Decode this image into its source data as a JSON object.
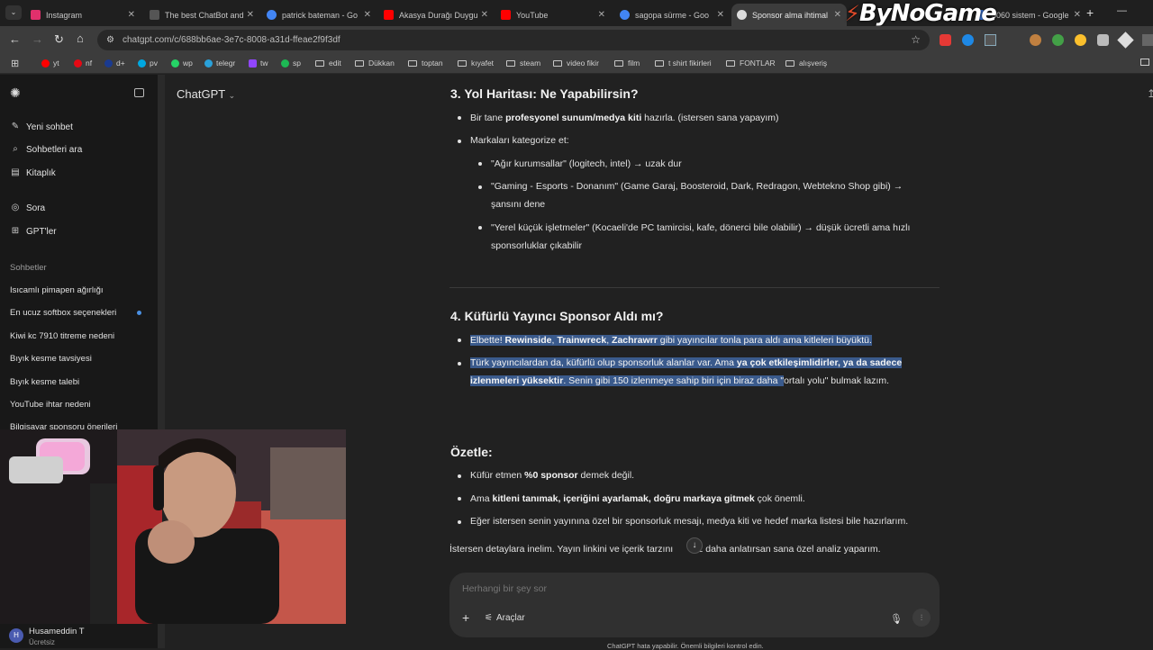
{
  "tabs": [
    {
      "title": "Instagram",
      "color": "#e1306c"
    },
    {
      "title": "The best ChatBot and",
      "color": "#444444"
    },
    {
      "title": "patrick bateman - Go",
      "color": "#4285f4"
    },
    {
      "title": "Akasya Durağı Duygu",
      "color": "#ff0000"
    },
    {
      "title": "YouTube",
      "color": "#ff0000"
    },
    {
      "title": "sagopa sürme - Goo",
      "color": "#4285f4"
    },
    {
      "title": "Sponsor alma ihtimal",
      "color": "#ffffff"
    },
    {
      "title": "5060 sistem - Google",
      "color": "#4285f4"
    }
  ],
  "new_tab": "+",
  "url": "chatgpt.com/c/688bb6ae-3e7c-8008-a31d-ffeae2f9f3df",
  "bookmarks": [
    "yt",
    "nf",
    "d+",
    "pv",
    "wp",
    "telegr",
    "tw",
    "sp",
    "edit",
    "Dükkan",
    "toptan",
    "kıyafet",
    "steam",
    "video fikir",
    "film",
    "t shirt fikirleri",
    "FONTLAR",
    "alışveriş"
  ],
  "logo": "ByNoGame",
  "sidebar": {
    "model": "ChatGPT",
    "nav": [
      {
        "label": "Yeni sohbet",
        "icon": "✎"
      },
      {
        "label": "Sohbetleri ara",
        "icon": "⌕"
      },
      {
        "label": "Kitaplık",
        "icon": "▤"
      },
      {
        "label": "Sora",
        "icon": "◎"
      },
      {
        "label": "GPT'ler",
        "icon": "⊞"
      }
    ],
    "section": "Sohbetler",
    "chats": [
      "Isıcamlı pimapen ağırlığı",
      "En ucuz softbox seçenekleri",
      "Kiwi kc 7910 titreme nedeni",
      "Bıyık kesme tavsiyesi",
      "Bıyık kesme talebi",
      "YouTube ihtar nedeni",
      "Bilgisayar sponsoru önerileri"
    ],
    "user_initial": "H",
    "user_name": "Husameddin T",
    "user_plan": "Ücretsiz"
  },
  "content": {
    "h3": "3. Yol Haritası: Ne Yapabilirsin?",
    "r1_a": "Bir tane ",
    "r1_b": "profesyonel sunum/medya kiti",
    "r1_c": " hazırla. (istersen sana yapayım)",
    "r2": "Markaları kategorize et:",
    "s1": "\"Ağır kurumsallar\" (logitech, intel) → uzak dur",
    "s2a": "\"Gaming - Esports - Donanım\" (Game Garaj, Boosteroid, Dark, Redragon, Webtekno Shop gibi) →",
    "s2b": "şansını dene",
    "s3a": "\"Yerel küçük işletmeler\" (Kocaeli'de PC tamircisi, kafe, dönerci bile olabilir) → düşük ücretli ama hızlı",
    "s3b": "sponsorluklar çıkabilir",
    "h4": "4. Küfürlü Yayıncı Sponsor Aldı mı?",
    "k1a": "Elbette! ",
    "k1b": "Rewinside",
    "k1c": ", ",
    "k1d": "Trainwreck",
    "k1e": ", ",
    "k1f": "Zachrawrr",
    "k1g": " gibi yayıncılar tonla para aldı ama kitleleri büyüktü.",
    "k2a": "Türk yayıncılardan da, küfürlü olup sponsorluk alanlar var. Ama ",
    "k2b": "ya çok etkileşimlidirler, ya da sadece",
    "k2c": "izlenmeleri yüksektir",
    "k2d": ". Senin gibi 150 izlenmeye sahip biri için biraz daha \"",
    "k2e": "ortalı yolu\" bulmak lazım.",
    "hs": "Özetle:",
    "o1a": "Küfür etmen ",
    "o1b": "%0 sponsor",
    "o1c": " demek değil.",
    "o2a": "Ama ",
    "o2b": "kitleni tanımak, içeriğini ayarlamak, doğru markaya gitmek",
    "o2c": " çok önemli.",
    "o3": "Eğer istersen senin yayınına özel bir sponsorluk mesajı, medya kiti ve hedef marka listesi bile hazırlarım.",
    "final_a": "İstersen detaylara inelim. Yayın linkini ve içerik tarzını",
    "final_b": "az daha anlatırsan sana özel analiz yaparım."
  },
  "composer": {
    "placeholder": "Herhangi bir şey sor",
    "plus": "+",
    "tools": "Araçlar",
    "footer": "ChatGPT hata yapabilir. Önemli bilgileri kontrol edin."
  },
  "colors": {
    "selection": "#3a5a8c",
    "background": "#212121",
    "sidebar": "#181818"
  }
}
